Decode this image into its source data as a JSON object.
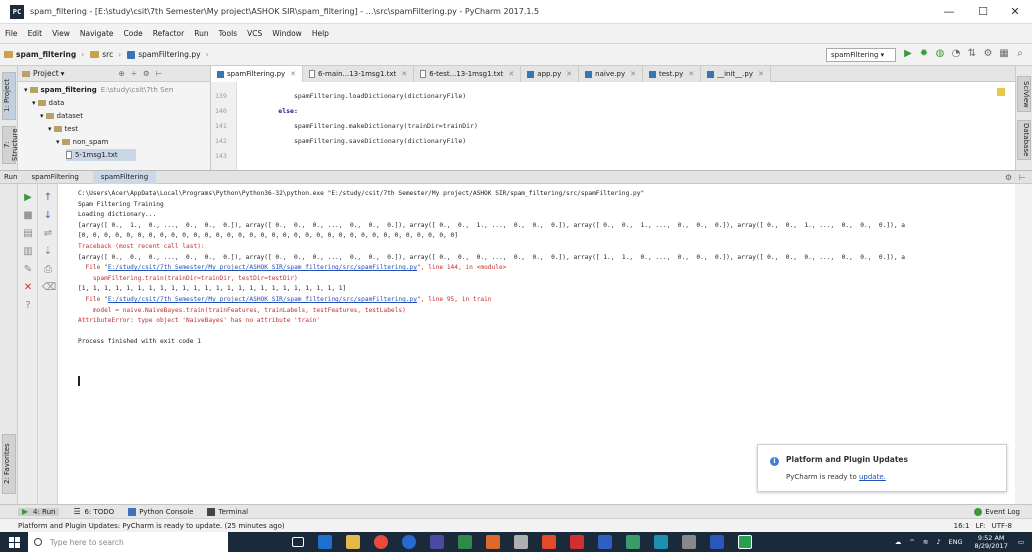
{
  "window": {
    "title": "spam_filtering - [E:\\study\\csit\\7th Semester\\My project\\ASHOK SIR\\spam_filtering] - ...\\src\\spamFiltering.py - PyCharm 2017.1.5",
    "controls": [
      "—",
      "☐",
      "✕"
    ]
  },
  "menu": [
    "File",
    "Edit",
    "View",
    "Navigate",
    "Code",
    "Refactor",
    "Run",
    "Tools",
    "VCS",
    "Window",
    "Help"
  ],
  "nav": {
    "crumbs": [
      "spam_filtering",
      "src",
      "spamFiltering.py"
    ],
    "run_config": "spamFiltering"
  },
  "left_tools": {
    "project": "1: Project",
    "structure": "7: Structure",
    "favorites": "2: Favorites"
  },
  "right_tools": {
    "scientific": "SciView",
    "database": "Database"
  },
  "project": {
    "header": "Project",
    "tree": [
      {
        "label": "spam_filtering",
        "path": "E:\\study\\csit\\7th Semester"
      },
      {
        "label": "data"
      },
      {
        "label": "dataset"
      },
      {
        "label": "test"
      },
      {
        "label": "non_spam"
      },
      {
        "label": "5-1msg1.txt"
      }
    ]
  },
  "editor": {
    "tabs": [
      "spamFiltering.py",
      "6-main...13-1msg1.txt",
      "6-test...13-1msg1.txt",
      "app.py",
      "naive.py",
      "test.py",
      "__init__.py"
    ],
    "line_numbers": [
      "139",
      "140",
      "141",
      "142",
      "143"
    ],
    "code_lines": [
      "            spamFiltering.loadDictionary(dictionaryFile)",
      "        else:",
      "            spamFiltering.makeDictionary(trainDir=trainDir)",
      "            spamFiltering.saveDictionary(dictionaryFile)",
      ""
    ]
  },
  "run_panel": {
    "label": "Run",
    "tabs": [
      "spamFiltering",
      "spamFiltering"
    ],
    "lines": [
      {
        "t": "C:\\Users\\Acer\\AppData\\Local\\Programs\\Python\\Python36-32\\python.exe \"E:/study/csit/7th Semester/My project/ASHOK SIR/spam_filtering/src/spamFiltering.py\"",
        "k": "normal"
      },
      {
        "t": "Spam Filtering Training",
        "k": "normal"
      },
      {
        "t": "Loading dictionary...",
        "k": "normal"
      },
      {
        "t": "[array([ 0.,  1.,  0., ...,  0.,  0.,  0.]), array([ 0.,  0.,  0., ...,  0.,  0.,  0.]), array([ 0.,  0.,  1., ...,  0.,  0.,  0.]), array([ 0.,  0.,  1., ...,  0.,  0.,  0.]), array([ 0.,  0.,  1., ...,  0.,  0.,  0.]), a",
        "k": "normal"
      },
      {
        "t": "[0, 0, 0, 0, 0, 0, 0, 0, 0, 0, 0, 0, 0, 0, 0, 0, 0, 0, 0, 0, 0, 0, 0, 0, 0, 0, 0, 0, 0, 0, 0, 0, 0, 0]",
        "k": "normal"
      },
      {
        "t": "Traceback (most recent call last):",
        "k": "err"
      },
      {
        "t": "[array([ 0.,  0.,  0., ...,  0.,  0.,  0.]), array([ 0.,  0.,  0., ...,  0.,  0.,  0.]), array([ 0.,  0.,  0., ...,  0.,  0.,  0.]), array([ 1.,  1.,  0., ...,  0.,  0.,  0.]), array([ 0.,  0.,  0., ...,  0.,  0.,  0.]), a",
        "k": "normal"
      },
      {
        "p": "  File \"",
        "l": "E:/study/csit/7th Semester/My project/ASHOK SIR/spam_filtering/src/spamFiltering.py",
        "s": "\", line 144, in <module>",
        "k": "err"
      },
      {
        "t": "    spamFiltering.train(trainDir=trainDir, testDir=testDir)",
        "k": "err"
      },
      {
        "t": "[1, 1, 1, 1, 1, 1, 1, 1, 1, 1, 1, 1, 1, 1, 1, 1, 1, 1, 1, 1, 1, 1, 1, 1]",
        "k": "normal"
      },
      {
        "p": "  File \"",
        "l": "E:/study/csit/7th Semester/My project/ASHOK SIR/spam_filtering/src/spamFiltering.py",
        "s": "\", line 95, in train",
        "k": "err"
      },
      {
        "t": "    model = naive.NaiveBayes.train(trainFeatures, trainLabels, testFeatures, testLabels)",
        "k": "err"
      },
      {
        "t": "AttributeError: type object 'NaiveBayes' has no attribute 'train'",
        "k": "err"
      },
      {
        "t": "",
        "k": "normal"
      },
      {
        "t": "Process finished with exit code 1",
        "k": "normal"
      }
    ]
  },
  "notification": {
    "title": "Platform and Plugin Updates",
    "body_prefix": "PyCharm is ready to ",
    "body_link": "update."
  },
  "tool_windows": [
    "4: Run",
    "6: TODO",
    "Python Console",
    "Terminal",
    "Event Log"
  ],
  "status": {
    "message": "Platform and Plugin Updates: PyCharm is ready to update. (25 minutes ago)",
    "right": "16:1 LF: UTF-8"
  },
  "taskbar": {
    "search_placeholder": "Type here to search",
    "time": "9:52 AM",
    "date": "8/29/2017",
    "lang": "ENG"
  },
  "colors": {
    "accent": "#3d73b6",
    "error_text": "#c03030",
    "link": "#2450b8",
    "taskbar": "#1b2a3b",
    "run_green": "#3a9a3a"
  }
}
